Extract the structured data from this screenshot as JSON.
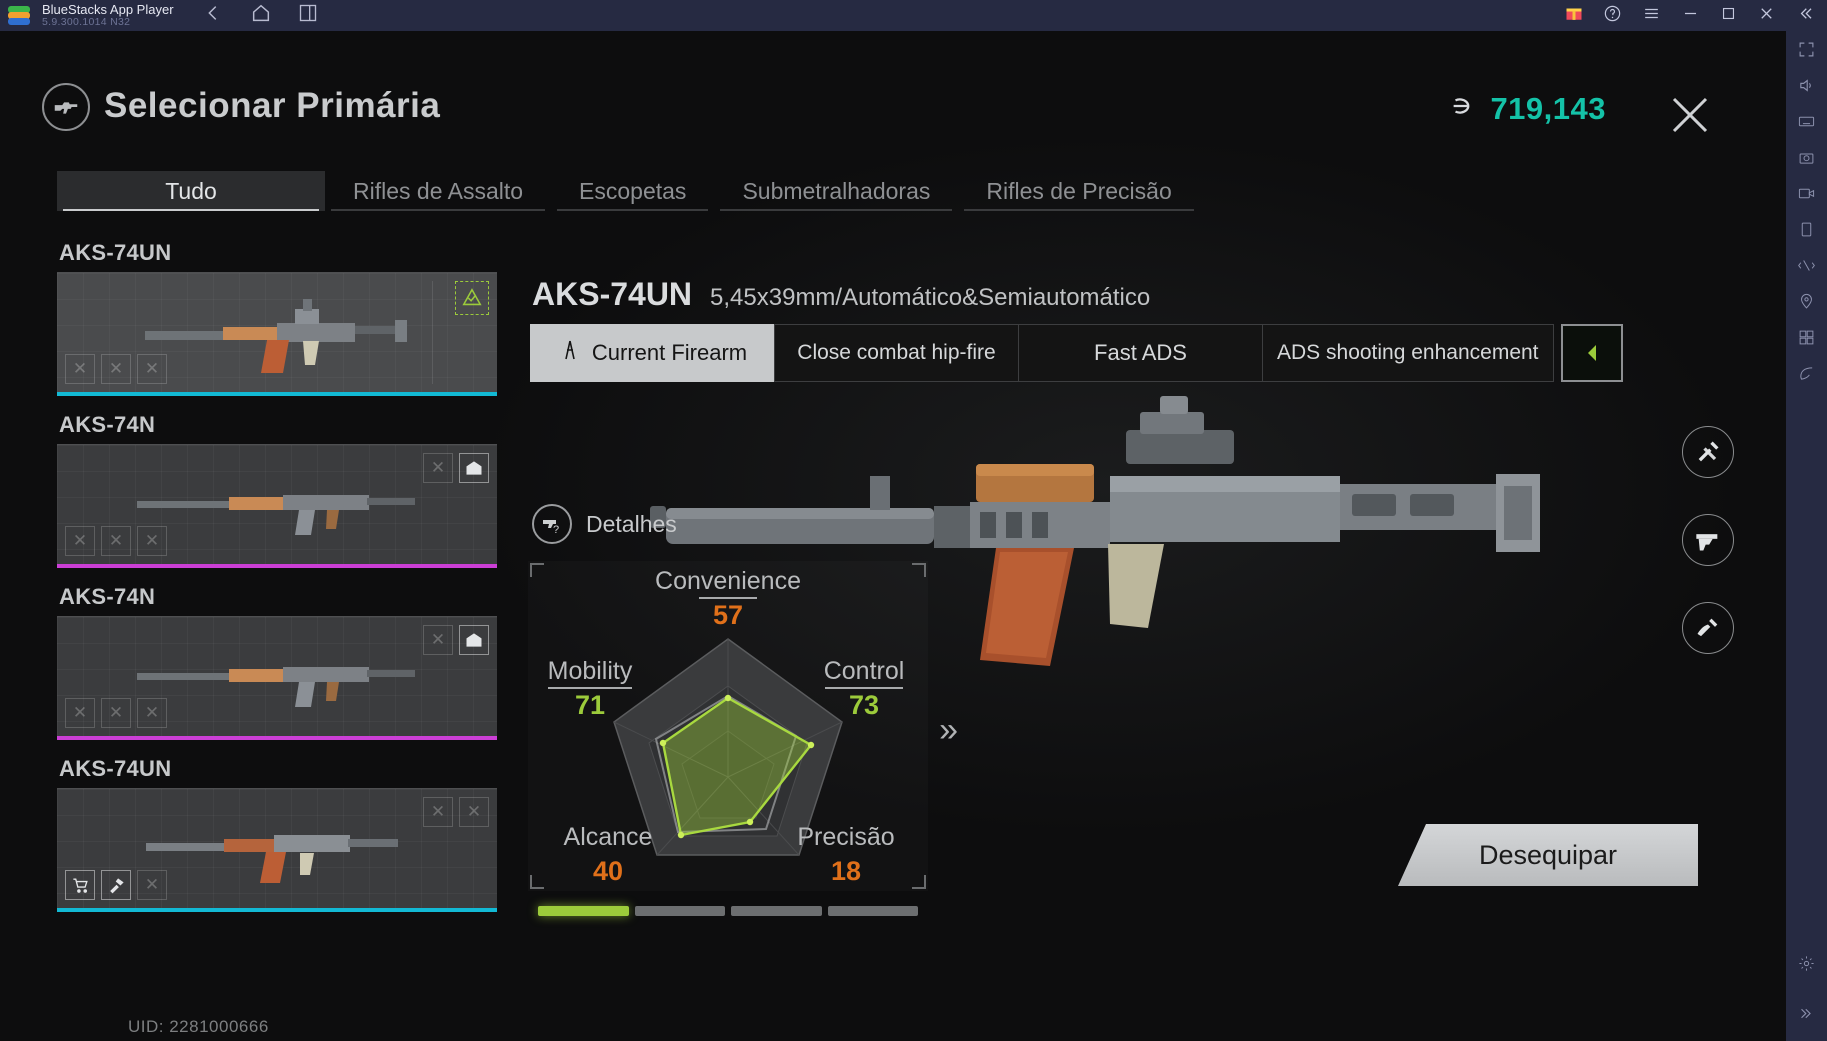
{
  "bluestacks": {
    "app_name": "BlueStacks App Player",
    "version": "5.9.300.1014  N32",
    "nav": [
      {
        "name": "back-icon",
        "label": "Back"
      },
      {
        "name": "home-icon",
        "label": "Home"
      },
      {
        "name": "multi-instance-icon",
        "label": "Instances"
      }
    ],
    "window_controls": [
      {
        "name": "gift-icon",
        "label": "Gift"
      },
      {
        "name": "help-icon",
        "label": "Help"
      },
      {
        "name": "menu-icon",
        "label": "Menu"
      },
      {
        "name": "minimize-icon",
        "label": "Minimize"
      },
      {
        "name": "maximize-icon",
        "label": "Maximize"
      },
      {
        "name": "close-icon",
        "label": "Close"
      },
      {
        "name": "collapse-sidebar-icon",
        "label": "Collapse"
      }
    ],
    "sidebar_tools": [
      "fullscreen-icon",
      "volume-icon",
      "keyboard-icon",
      "screenshot-icon",
      "record-icon",
      "rotate-icon",
      "shake-icon",
      "location-icon",
      "multi-instance-sync-icon",
      "eco-mode-icon",
      "settings-icon",
      "expand-icon"
    ]
  },
  "header": {
    "title": "Selecionar Primária",
    "title_icon": "rifle-circle-icon",
    "currency_symbol": "currency-icon",
    "currency_value": "719,143",
    "currency_color": "#14c2a8",
    "close_label": "close-icon"
  },
  "tabs": [
    {
      "label": "Tudo",
      "active": true
    },
    {
      "label": "Rifles de Assalto",
      "active": false
    },
    {
      "label": "Escopetas",
      "active": false
    },
    {
      "label": "Submetralhadoras",
      "active": false
    },
    {
      "label": "Rifles de Precisão",
      "active": false
    }
  ],
  "weapon_list": [
    {
      "name": "AKS-74UN",
      "selected": true,
      "rarity_color": "#12b9d4",
      "badge": "equipped-check-icon",
      "badge_type": "equipped",
      "slots": [
        "x",
        "x",
        "x"
      ]
    },
    {
      "name": "AKS-74N",
      "selected": false,
      "rarity_color": "#cc3fd6",
      "badge": "storage-icon",
      "badge_type": "store",
      "slots": [
        "x",
        "x",
        "x"
      ]
    },
    {
      "name": "AKS-74N",
      "selected": false,
      "rarity_color": "#cc3fd6",
      "badge": "storage-icon",
      "badge_type": "store",
      "slots": [
        "x",
        "x",
        "x"
      ]
    },
    {
      "name": "AKS-74UN",
      "selected": false,
      "rarity_color": "#12b9d4",
      "badge": "none",
      "badge_type": "none",
      "slots": [
        "cart",
        "craft",
        "x"
      ]
    }
  ],
  "detail": {
    "weapon_name": "AKS-74UN",
    "caliber": "5,45x39mm/Automático&Semiautomático",
    "presets": [
      {
        "label": "Current Firearm",
        "active": true,
        "icon": "caliper-icon"
      },
      {
        "label": "Close combat hip-fire",
        "active": false,
        "icon": ""
      },
      {
        "label": "Fast ADS",
        "active": false,
        "icon": ""
      },
      {
        "label": "ADS shooting enhancement",
        "active": false,
        "icon": ""
      }
    ],
    "expand_button": "prev-preset-chevron-icon",
    "details_label": "Detalhes",
    "details_icon": "pistol-question-icon",
    "next_page_icon": "chevron-right-double-icon",
    "segments": [
      true,
      false,
      false,
      false
    ],
    "rail_icons": [
      {
        "name": "modify-tools-icon"
      },
      {
        "name": "pistol-icon"
      },
      {
        "name": "weapon-skin-icon"
      }
    ],
    "unequip_label": "Desequipar"
  },
  "chart_data": {
    "type": "radar",
    "title": "Detalhes",
    "categories": [
      "Convenience",
      "Control",
      "Precisão",
      "Alcance",
      "Mobility"
    ],
    "values": [
      57,
      73,
      18,
      40,
      71
    ],
    "value_colors": [
      "#e0701a",
      "#9ccb3b",
      "#e0701a",
      "#e0701a",
      "#9ccb3b"
    ],
    "max": 100,
    "series": [
      {
        "name": "AKS-74UN",
        "values": [
          57,
          73,
          18,
          40,
          71
        ]
      }
    ],
    "fill_color": "#9ccb3b",
    "grid": true,
    "legend": "none"
  },
  "footer": {
    "uid_label": "UID: 2281000666"
  }
}
